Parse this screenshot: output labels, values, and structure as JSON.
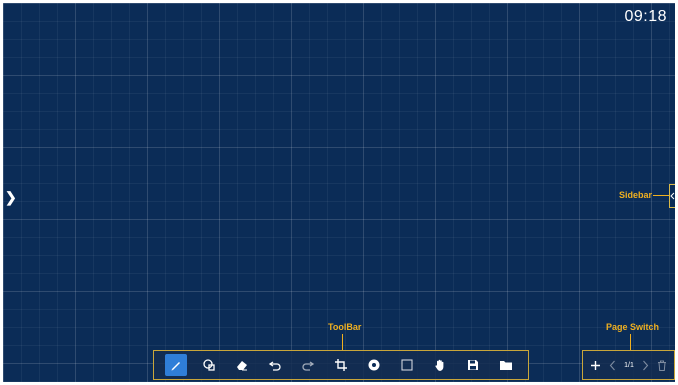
{
  "clock": {
    "time": "09:18"
  },
  "annotations": {
    "sidebar": "Sidebar",
    "toolbar": "ToolBar",
    "page_switch": "Page Switch"
  },
  "toolbar": {
    "tools": [
      "pen-icon",
      "shape-recognition-icon",
      "eraser-icon",
      "undo-icon",
      "redo-icon",
      "crop-icon",
      "color-icon",
      "select-icon",
      "hand-icon",
      "save-icon",
      "folder-icon"
    ],
    "active": "pen-icon"
  },
  "pager": {
    "page": "1/1"
  },
  "colors": {
    "board": "#0b2c57",
    "accent": "#2f7ed8",
    "callout": "#f0b020"
  }
}
